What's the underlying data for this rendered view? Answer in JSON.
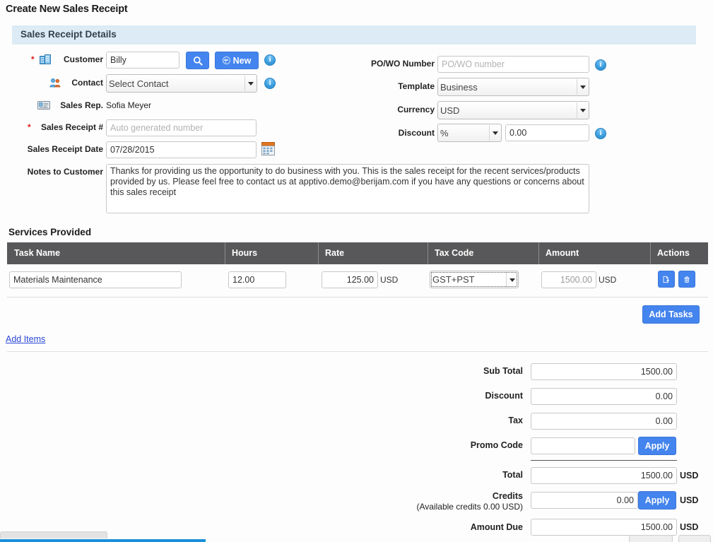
{
  "page": {
    "title": "Create New Sales Receipt"
  },
  "section": {
    "header": "Sales Receipt Details"
  },
  "left_form": {
    "customer": {
      "label": "Customer",
      "required_mark": "*",
      "value": "Billy",
      "icon": "building-icon",
      "search_button": "search-icon",
      "new_button_label": "New",
      "info": "i"
    },
    "contact": {
      "label": "Contact",
      "value": "Select Contact",
      "options": [
        "Select Contact"
      ],
      "icon": "contacts-icon",
      "info": "i"
    },
    "sales_rep": {
      "label": "Sales Rep.",
      "value": "Sofia Meyer",
      "icon": "id-card-icon"
    },
    "sales_receipt_number": {
      "label": "Sales Receipt #",
      "required_mark": "*",
      "value": "",
      "placeholder": "Auto generated number"
    },
    "sales_receipt_date": {
      "label": "Sales Receipt Date",
      "value": "07/28/2015",
      "calendar_icon": "calendar-icon"
    },
    "notes": {
      "label": "Notes to Customer",
      "value": "Thanks for providing us the opportunity to do business with you. This is the sales receipt for the recent services/products provided by us. Please feel free to contact us at apptivo.demo@berijam.com if you have any questions or concerns about this sales receipt"
    }
  },
  "right_form": {
    "po_wo_number": {
      "label": "PO/WO Number",
      "value": "",
      "placeholder": "PO/WO number",
      "info": "i"
    },
    "template": {
      "label": "Template",
      "value": "Business",
      "options": [
        "Business"
      ]
    },
    "currency": {
      "label": "Currency",
      "value": "USD",
      "options": [
        "USD"
      ]
    },
    "discount": {
      "label": "Discount",
      "type_value": "%",
      "type_options": [
        "%"
      ],
      "amount_value": "0.00",
      "info": "i"
    }
  },
  "services": {
    "title": "Services Provided",
    "columns": [
      "Task Name",
      "Hours",
      "Rate",
      "Tax Code",
      "Amount",
      "Actions"
    ],
    "rows": [
      {
        "task_name": "Materials Maintenance",
        "hours": "12.00",
        "rate": "125.00",
        "rate_unit": "USD",
        "tax_code": "GST+PST",
        "tax_code_options": [
          "GST+PST"
        ],
        "amount": "1500.00",
        "amount_unit": "USD",
        "actions": [
          "add-row-icon",
          "delete-row-icon"
        ]
      }
    ],
    "add_tasks_button": "Add Tasks",
    "add_items_link": "Add Items"
  },
  "totals": {
    "sub_total": {
      "label": "Sub Total",
      "value": "1500.00"
    },
    "discount": {
      "label": "Discount",
      "value": "0.00"
    },
    "tax": {
      "label": "Tax",
      "value": "0.00"
    },
    "promo_code": {
      "label": "Promo Code",
      "value": "",
      "apply_label": "Apply"
    },
    "total": {
      "label": "Total",
      "value": "1500.00",
      "unit": "USD"
    },
    "credits": {
      "label": "Credits",
      "sub_label": "(Available credits  0.00  USD)",
      "value": "0.00",
      "apply_label": "Apply",
      "unit": "USD"
    },
    "amount_due": {
      "label": "Amount Due",
      "value": "1500.00",
      "unit": "USD"
    }
  },
  "colors": {
    "accent_blue": "#4484ee",
    "band_blue": "#dcebf5",
    "table_header_grey": "#58585a",
    "link_blue": "#2a46d8",
    "required_red": "#e01b1b",
    "taskbar_blue": "#1b8fd8"
  }
}
